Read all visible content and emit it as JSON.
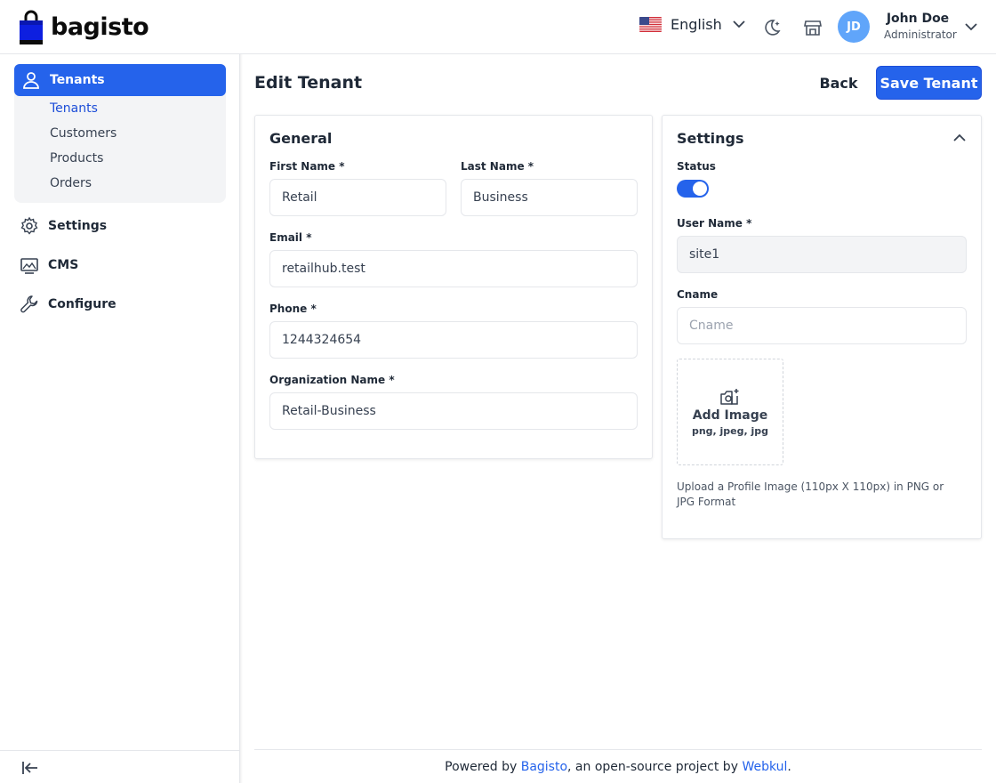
{
  "header": {
    "logo_text": "bagisto",
    "language": "English",
    "user": {
      "initials": "JD",
      "name": "John Doe",
      "role": "Administrator"
    }
  },
  "sidebar": {
    "group": {
      "label": "Tenants",
      "items": [
        {
          "label": "Tenants",
          "active": true
        },
        {
          "label": "Customers"
        },
        {
          "label": "Products"
        },
        {
          "label": "Orders"
        }
      ]
    },
    "items": [
      {
        "label": "Settings",
        "icon": "gear-icon"
      },
      {
        "label": "CMS",
        "icon": "cms-icon"
      },
      {
        "label": "Configure",
        "icon": "wrench-icon"
      }
    ]
  },
  "page": {
    "title": "Edit Tenant",
    "back_label": "Back",
    "save_label": "Save Tenant"
  },
  "general": {
    "title": "General",
    "first_name": {
      "label": "First Name *",
      "value": "Retail"
    },
    "last_name": {
      "label": "Last Name *",
      "value": "Business"
    },
    "email": {
      "label": "Email *",
      "value": "retailhub.test"
    },
    "phone": {
      "label": "Phone *",
      "value": "1244324654"
    },
    "organization": {
      "label": "Organization Name *",
      "value": "Retail-Business"
    }
  },
  "settings": {
    "title": "Settings",
    "status_label": "Status",
    "status_on": true,
    "username": {
      "label": "User Name *",
      "value": "site1"
    },
    "cname": {
      "label": "Cname",
      "placeholder": "Cname"
    },
    "upload": {
      "title": "Add Image",
      "formats": "png, jpeg, jpg",
      "help": "Upload a Profile Image (110px X 110px) in PNG or JPG Format"
    }
  },
  "footer": {
    "prefix": "Powered by ",
    "link1": "Bagisto",
    "middle": ", an open-source project by ",
    "link2": "Webkul",
    "suffix": "."
  },
  "colors": {
    "primary": "#2563eb",
    "avatar": "#60a5fa",
    "border": "#e5e7eb"
  }
}
